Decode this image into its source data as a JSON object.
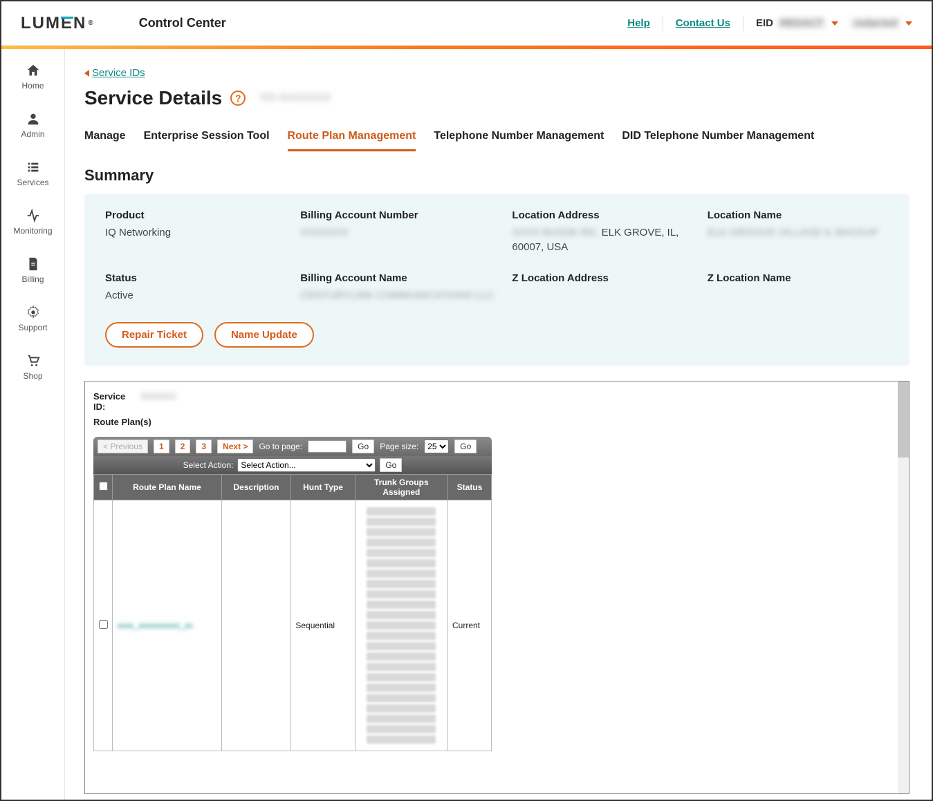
{
  "header": {
    "logo_text": "LUMEN",
    "app_title": "Control Center",
    "help_label": "Help",
    "contact_label": "Contact Us",
    "eid_label": "EID",
    "eid_value": "REDACT",
    "user_value": "redacted"
  },
  "sidebar": {
    "items": [
      {
        "id": "home",
        "label": "Home"
      },
      {
        "id": "admin",
        "label": "Admin"
      },
      {
        "id": "services",
        "label": "Services"
      },
      {
        "id": "monitoring",
        "label": "Monitoring"
      },
      {
        "id": "billing",
        "label": "Billing"
      },
      {
        "id": "support",
        "label": "Support"
      },
      {
        "id": "shop",
        "label": "Shop"
      }
    ]
  },
  "page": {
    "back_link": "Service IDs",
    "title": "Service Details",
    "sub_id": "VO-AXXXXXX"
  },
  "tabs": [
    {
      "id": "manage",
      "label": "Manage"
    },
    {
      "id": "est",
      "label": "Enterprise Session Tool"
    },
    {
      "id": "rpm",
      "label": "Route Plan Management"
    },
    {
      "id": "tnm",
      "label": "Telephone Number Management"
    },
    {
      "id": "dtnm",
      "label": "DID Telephone Number Management"
    }
  ],
  "active_tab": "rpm",
  "section_title": "Summary",
  "summary": {
    "product": {
      "label": "Product",
      "value": "IQ Networking"
    },
    "ban": {
      "label": "Billing Account Number",
      "value": "XXXXXXX"
    },
    "location_address": {
      "label": "Location Address",
      "value_blur": "XXXX BUSSE RD,",
      "value_clear": " ELK GROVE, IL, 60007, USA"
    },
    "location_name": {
      "label": "Location Name",
      "value": "ELK GROOVE VILLAGE IL BACKUP"
    },
    "status": {
      "label": "Status",
      "value": "Active"
    },
    "ba_name": {
      "label": "Billing Account Name",
      "value": "CENTURYLINK COMMUNICATIONS LLC"
    },
    "z_loc_addr": {
      "label": "Z Location Address",
      "value": ""
    },
    "z_loc_name": {
      "label": "Z Location Name",
      "value": ""
    }
  },
  "buttons": {
    "repair": "Repair Ticket",
    "name_update": "Name Update"
  },
  "widget": {
    "service_id_label": "Service ID:",
    "service_id_value": "XXXXXX",
    "route_plans_label": "Route Plan(s)",
    "pager": {
      "prev": "< Previous",
      "pages": [
        "1",
        "2",
        "3"
      ],
      "next": "Next >",
      "goto_label": "Go to page:",
      "go": "Go",
      "page_size_label": "Page size:",
      "page_size_value": "25"
    },
    "action": {
      "label": "Select Action:",
      "placeholder": "Select Action...",
      "go": "Go"
    },
    "columns": {
      "chk": "",
      "name": "Route Plan Name",
      "desc": "Description",
      "hunt": "Hunt Type",
      "tg": "Trunk Groups Assigned",
      "status": "Status"
    },
    "row": {
      "name": "xxxx_xxxxxxxxxx_xx",
      "desc": "",
      "hunt": "Sequential",
      "tg_count": 23,
      "status": "Current"
    }
  }
}
